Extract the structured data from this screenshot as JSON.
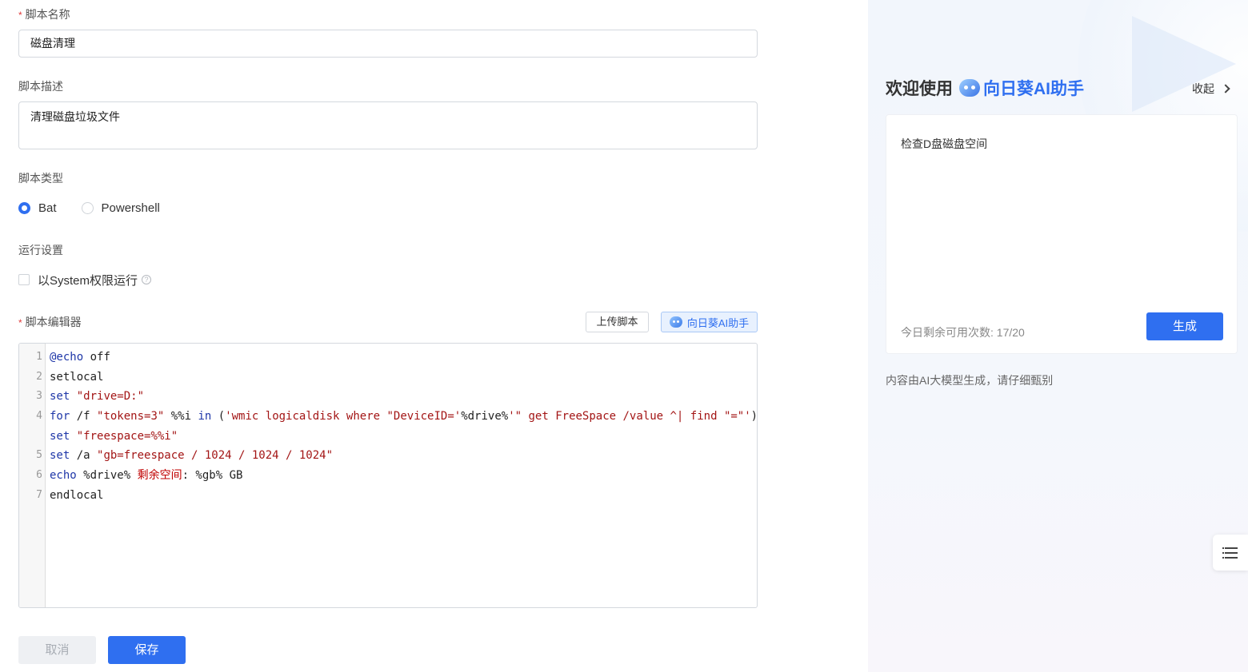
{
  "form": {
    "name_label": "脚本名称",
    "name_value": "磁盘清理",
    "desc_label": "脚本描述",
    "desc_value": "清理磁盘垃圾文件",
    "type_label": "脚本类型",
    "type_options": [
      "Bat",
      "Powershell"
    ],
    "type_selected": "Bat",
    "run_label": "运行设置",
    "run_system_label": "以System权限运行",
    "run_system_checked": false,
    "editor_label": "脚本编辑器",
    "upload_button": "上传脚本",
    "ai_button": "向日葵AI助手",
    "cancel_button": "取消",
    "save_button": "保存"
  },
  "editor": {
    "line_numbers": [
      "1",
      "2",
      "3",
      "4",
      "",
      "5",
      "6",
      "7"
    ],
    "lines": [
      "@echo off",
      "setlocal",
      "set \"drive=D:\"",
      "for /f \"tokens=3\" %%i in ('wmic logicaldisk where \"DeviceID='%drive%'\" get FreeSpace /value ^| find \"=\"') do",
      "set \"freespace=%%i\"",
      "set /a \"gb=freespace / 1024 / 1024 / 1024\"",
      "echo %drive% 剩余空间: %gb% GB",
      "endlocal"
    ]
  },
  "panel": {
    "welcome_prefix": "欢迎使用",
    "brand": "向日葵AI助手",
    "collapse": "收起",
    "prompt": "检查D盘磁盘空间",
    "remaining": "今日剩余可用次数: 17/20",
    "generate_button": "生成",
    "disclaimer": "内容由AI大模型生成，请仔细甄别"
  },
  "colors": {
    "accent": "#2f6ff0",
    "required": "#e03a3a",
    "keyword": "#1f37a8",
    "string": "#a31515"
  }
}
